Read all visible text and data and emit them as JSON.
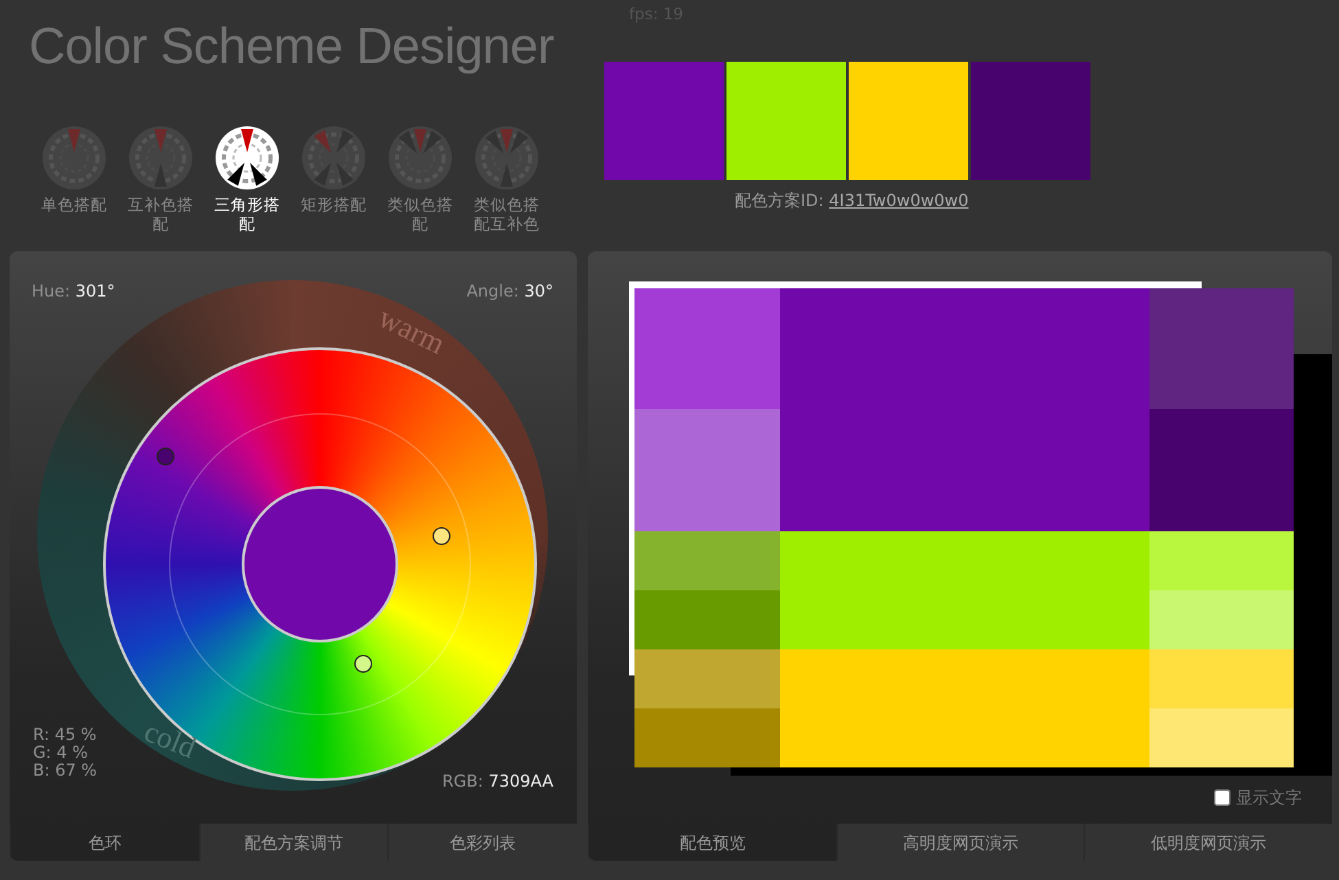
{
  "app": {
    "title": "Color Scheme Designer",
    "fps": "fps: 19"
  },
  "scheme_types": [
    {
      "kind": "mono",
      "label": "单色搭配",
      "selected": false
    },
    {
      "kind": "complement",
      "label": "互补色搭配",
      "selected": false
    },
    {
      "kind": "triad",
      "label": "三角形搭配",
      "selected": true
    },
    {
      "kind": "tetrad",
      "label": "矩形搭配",
      "selected": false
    },
    {
      "kind": "analogic",
      "label": "类似色搭配",
      "selected": false
    },
    {
      "kind": "accented",
      "label": "类似色搭配互补色",
      "selected": false
    }
  ],
  "swatches": [
    {
      "color": "#7109aa"
    },
    {
      "color": "#9fee00"
    },
    {
      "color": "#ffd300"
    },
    {
      "color": "#48036f"
    }
  ],
  "scheme_id": {
    "label": "配色方案ID:",
    "value": "4I31Tw0w0w0w0"
  },
  "color_wheel": {
    "hue_label": "Hue:",
    "hue": "301°",
    "angle_label": "Angle:",
    "angle": "30°",
    "warm": "warm",
    "cold": "cold",
    "rgb_percent": [
      {
        "label": "R:",
        "value": "45 %"
      },
      {
        "label": "G:",
        "value": "4 %"
      },
      {
        "label": "B:",
        "value": "67 %"
      }
    ],
    "rgb_label": "RGB:",
    "rgb": "7309AA",
    "markers": [
      {
        "color": "#48036f"
      },
      {
        "color": "#ffe580"
      },
      {
        "color": "#d4f78c"
      }
    ]
  },
  "left_tabs": [
    {
      "label": "色环",
      "selected": true
    },
    {
      "label": "配色方案调节",
      "selected": false
    },
    {
      "label": "色彩列表",
      "selected": false
    }
  ],
  "preview": {
    "rows": [
      {
        "left": [
          {
            "color": "#a23cd5"
          },
          {
            "color": "#ad66d5"
          }
        ],
        "main": {
          "color": "#7109aa"
        },
        "right": [
          {
            "color": "#5f2580"
          },
          {
            "color": "#48036f"
          }
        ]
      },
      {
        "left": [
          {
            "color": "#86b32d"
          },
          {
            "color": "#679b00"
          }
        ],
        "main": {
          "color": "#9fee00"
        },
        "right": [
          {
            "color": "#b9f73e"
          },
          {
            "color": "#c9f76f"
          }
        ]
      },
      {
        "left": [
          {
            "color": "#bfa730"
          },
          {
            "color": "#a68900"
          }
        ],
        "main": {
          "color": "#ffd300"
        },
        "right": [
          {
            "color": "#ffde40"
          },
          {
            "color": "#ffe773"
          }
        ]
      }
    ],
    "show_text": {
      "label": "显示文字",
      "checked": false
    }
  },
  "right_tabs": [
    {
      "label": "配色预览",
      "selected": true
    },
    {
      "label": "高明度网页演示",
      "selected": false
    },
    {
      "label": "低明度网页演示",
      "selected": false
    }
  ]
}
